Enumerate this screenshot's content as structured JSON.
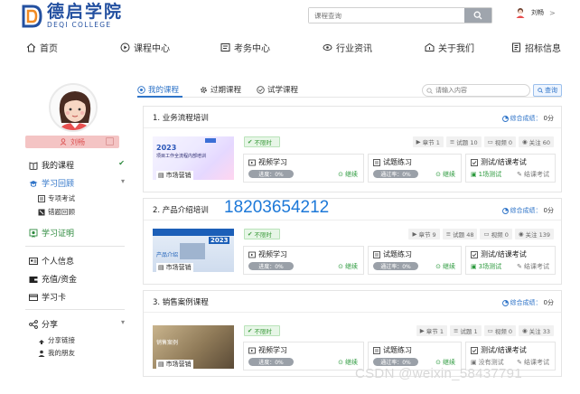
{
  "header": {
    "logo_cn": "德启学院",
    "logo_en": "DEQI COLLEGE",
    "search_placeholder": "课程查询",
    "user_name": "刘畅",
    "user_arrow": ">"
  },
  "nav": [
    {
      "label": "首页",
      "icon": "home-icon"
    },
    {
      "label": "课程中心",
      "icon": "course-icon"
    },
    {
      "label": "考务中心",
      "icon": "exam-icon"
    },
    {
      "label": "行业资讯",
      "icon": "news-icon"
    },
    {
      "label": "关于我们",
      "icon": "about-icon"
    },
    {
      "label": "招标信息",
      "icon": "tender-icon"
    }
  ],
  "sidebar": {
    "name": "刘畅",
    "my_courses": "我的课程",
    "study_review": "学习回顾",
    "special_exam": "专项考试",
    "wrong_review": "错题回顾",
    "certificate": "学习证明",
    "personal_info": "个人信息",
    "recharge": "充值/资金",
    "study_card": "学习卡",
    "share": "分享",
    "share_link": "分享链接",
    "my_friends": "我的朋友"
  },
  "main": {
    "tabs": [
      "我的课程",
      "过期课程",
      "试学课程"
    ],
    "search_placeholder": "请输入内容",
    "query_label": "查询",
    "score_label": "综合成绩：",
    "score_value": "0分",
    "status_label": "不限时",
    "video_label": "视频学习",
    "practice_label": "试题练习",
    "exam_label": "测试/结课考试",
    "progress_text": "进度：0%",
    "pass_text": "通过率：0%",
    "continue_label": "继续",
    "finish_exam_label": "结课考试",
    "thumb_caption": "市场营销",
    "courses": [
      {
        "title": "1. 业务流程培训",
        "stats": [
          "章节 1",
          "试题 10",
          "视频 0",
          "关注 60"
        ],
        "test_text": "1场测试",
        "thumb_year": "2023",
        "thumb_text": "项目工作全流程内部培训"
      },
      {
        "title": "2. 产品介绍培训",
        "stats": [
          "章节 9",
          "试题 48",
          "视频 0",
          "关注 139"
        ],
        "test_text": "3场测试",
        "thumb_year": "2023",
        "thumb_text": "产品介绍"
      },
      {
        "title": "3. 销售案例课程",
        "stats": [
          "章节 1",
          "试题 1",
          "视频 0",
          "关注 33"
        ],
        "test_text": "没有测试",
        "thumb_year": "",
        "thumb_text": "销售案例"
      }
    ]
  },
  "overlay_phone": "18203654212",
  "watermark": "CSDN @weixin_58437791"
}
